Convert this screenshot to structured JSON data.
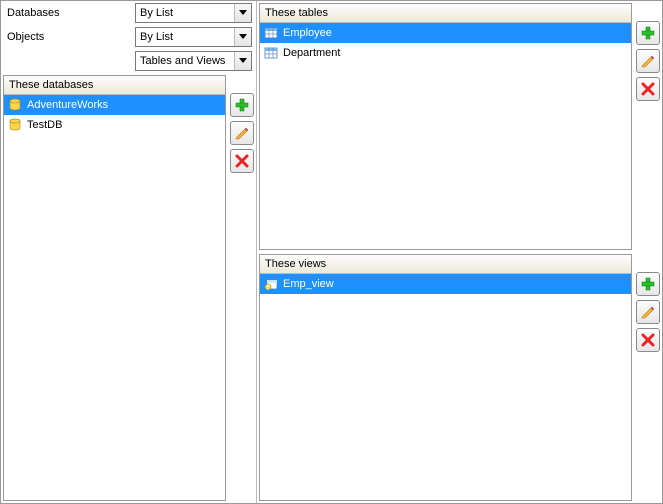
{
  "filters": {
    "databases_label": "Databases",
    "objects_label": "Objects",
    "databases_value": "By List",
    "objects_value": "By List",
    "scope_value": "Tables and Views"
  },
  "databases": {
    "header": "These databases",
    "items": [
      {
        "label": "AdventureWorks",
        "selected": true
      },
      {
        "label": "TestDB",
        "selected": false
      }
    ]
  },
  "tables": {
    "header": "These tables",
    "items": [
      {
        "label": "Employee",
        "selected": true
      },
      {
        "label": "Department",
        "selected": false
      }
    ]
  },
  "views": {
    "header": "These views",
    "items": [
      {
        "label": "Emp_view",
        "selected": true
      }
    ]
  }
}
